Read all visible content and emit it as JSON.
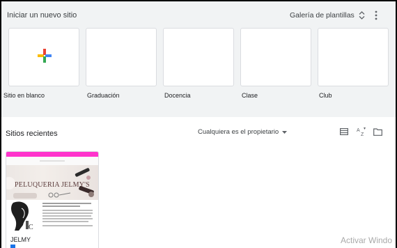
{
  "header": {
    "title": "Iniciar un nuevo sitio",
    "gallery_label": "Galería de plantillas"
  },
  "templates": [
    {
      "label": "Sitio en blanco",
      "icon": "plus-icon"
    },
    {
      "label": "Graduación"
    },
    {
      "label": "Docencia"
    },
    {
      "label": "Clase"
    },
    {
      "label": "Club"
    }
  ],
  "recent": {
    "title": "Sitios recientes",
    "owner_filter": "Cualquiera es el propietario"
  },
  "sites": [
    {
      "name": "JELMY",
      "banner_text": "PELUQUERIA JELMY'S"
    }
  ],
  "watermark": "Activar Windo",
  "colors": {
    "accent_pink": "#ff33cc",
    "plus_red": "#ea4335",
    "plus_blue": "#4285f4",
    "plus_green": "#34a853",
    "plus_yellow": "#fbbc04"
  }
}
